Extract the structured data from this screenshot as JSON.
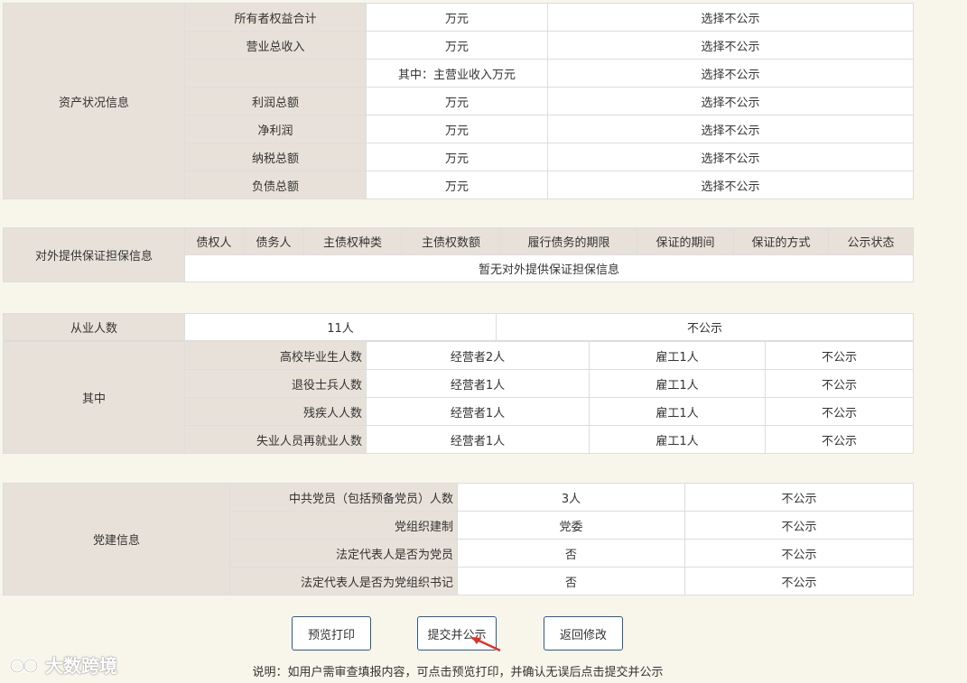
{
  "assets": {
    "group_label": "资产状况信息",
    "rows": [
      {
        "label": "所有者权益合计",
        "value": "万元",
        "status": "选择不公示"
      },
      {
        "label": "营业总收入",
        "value": "万元",
        "status": "选择不公示"
      },
      {
        "label": "",
        "value": "其中：主营业收入万元",
        "status": "选择不公示"
      },
      {
        "label": "利润总额",
        "value": "万元",
        "status": "选择不公示"
      },
      {
        "label": "净利润",
        "value": "万元",
        "status": "选择不公示"
      },
      {
        "label": "纳税总额",
        "value": "万元",
        "status": "选择不公示"
      },
      {
        "label": "负债总额",
        "value": "万元",
        "status": "选择不公示"
      }
    ]
  },
  "guarantee": {
    "group_label": "对外提供保证担保信息",
    "headers": [
      "债权人",
      "债务人",
      "主债权种类",
      "主债权数额",
      "履行债务的期限",
      "保证的期间",
      "保证的方式",
      "公示状态"
    ],
    "empty_text": "暂无对外提供保证担保信息"
  },
  "employees": {
    "label": "从业人数",
    "count": "11人",
    "status": "不公示",
    "group_label": "其中",
    "rows": [
      {
        "label": "高校毕业生人数",
        "operator": "经营者2人",
        "employee": "雇工1人",
        "status": "不公示"
      },
      {
        "label": "退役士兵人数",
        "operator": "经营者1人",
        "employee": "雇工1人",
        "status": "不公示"
      },
      {
        "label": "残疾人人数",
        "operator": "经营者1人",
        "employee": "雇工1人",
        "status": "不公示"
      },
      {
        "label": "失业人员再就业人数",
        "operator": "经营者1人",
        "employee": "雇工1人",
        "status": "不公示"
      }
    ]
  },
  "party": {
    "group_label": "党建信息",
    "rows": [
      {
        "label": "中共党员（包括预备党员）人数",
        "value": "3人",
        "status": "不公示"
      },
      {
        "label": "党组织建制",
        "value": "党委",
        "status": "不公示"
      },
      {
        "label": "法定代表人是否为党员",
        "value": "否",
        "status": "不公示"
      },
      {
        "label": "法定代表人是否为党组织书记",
        "value": "否",
        "status": "不公示"
      }
    ]
  },
  "actions": {
    "preview_label": "预览打印",
    "submit_label": "提交并公示",
    "back_label": "返回修改"
  },
  "note": "说明：如用户需审查填报内容，可点击预览打印，并确认无误后点击提交并公示",
  "watermark": "大数跨境",
  "colors": {
    "label_bg": "#e8e1d9",
    "page_bg": "#f8f5ea",
    "button_border": "#2e5a86",
    "arrow": "#d9342b"
  }
}
